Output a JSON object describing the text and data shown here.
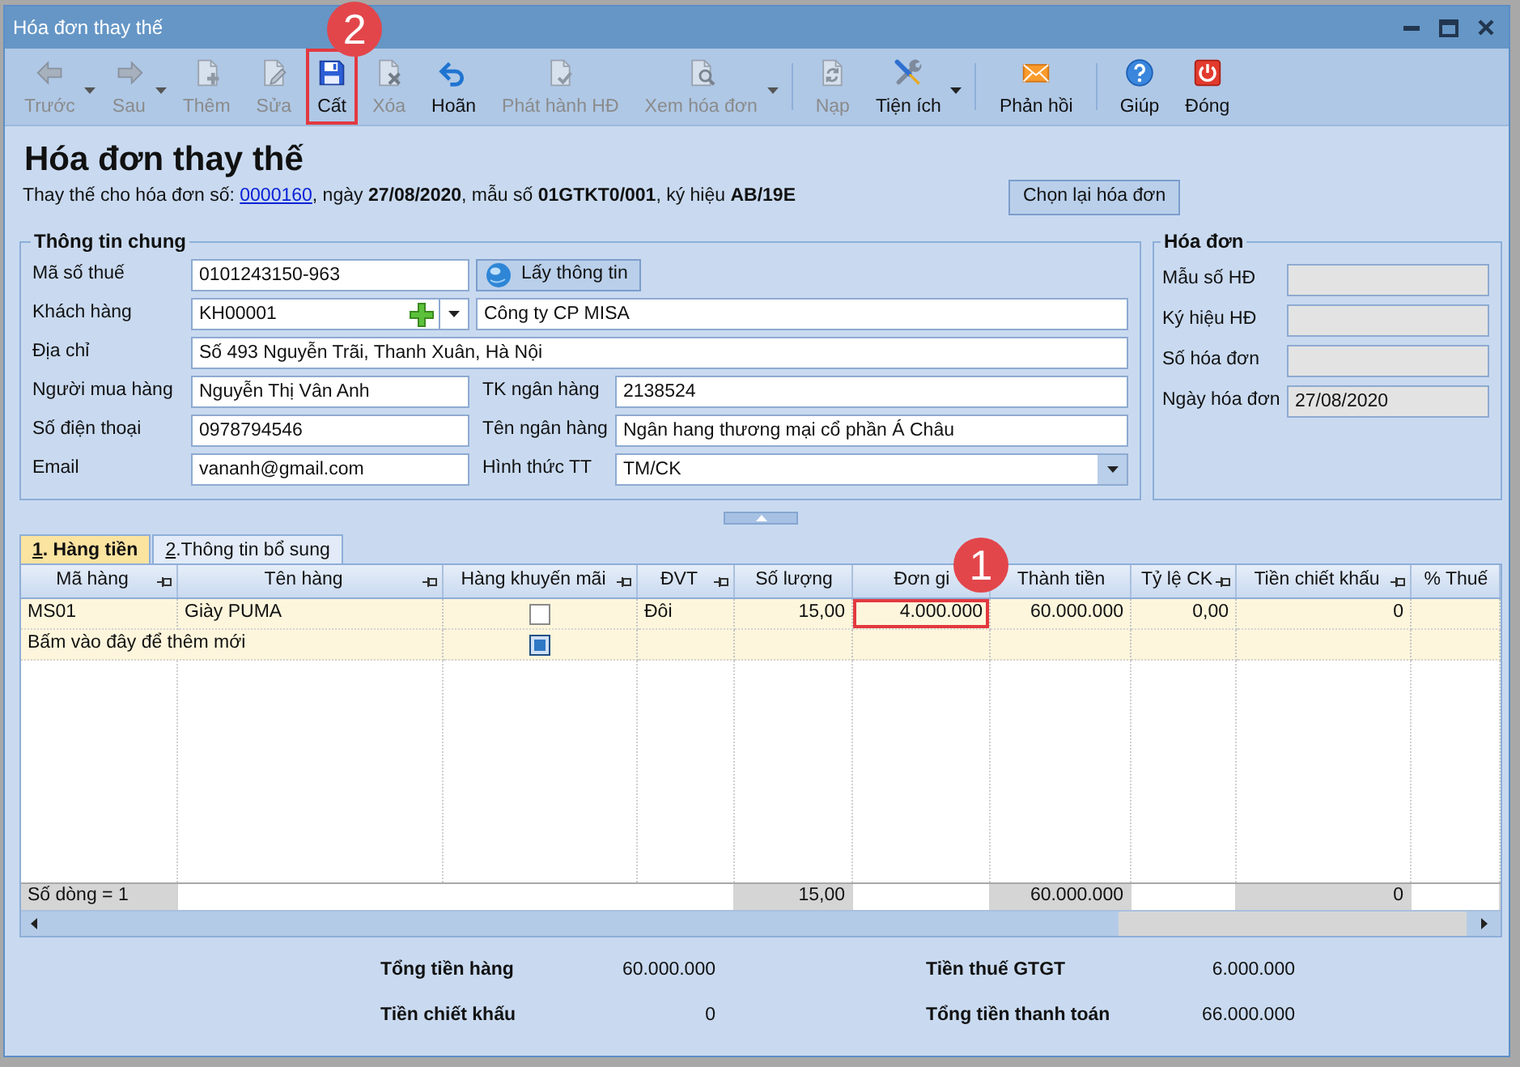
{
  "window": {
    "title": "Hóa đơn thay thế"
  },
  "toolbar": [
    {
      "buttons": [
        {
          "kind": "back",
          "label": "Trước",
          "disabled": true,
          "dropdown": true
        },
        {
          "kind": "forward",
          "label": "Sau",
          "disabled": true,
          "dropdown": true
        },
        {
          "kind": "add",
          "label": "Thêm",
          "disabled": true,
          "dropdown": false
        },
        {
          "kind": "edit",
          "label": "Sửa",
          "disabled": true,
          "dropdown": false
        },
        {
          "kind": "save",
          "label": "Cất",
          "disabled": false,
          "dropdown": false,
          "callout": "2"
        },
        {
          "kind": "delete",
          "label": "Xóa",
          "disabled": true,
          "dropdown": false
        },
        {
          "kind": "undo",
          "label": "Hoãn",
          "disabled": false,
          "dropdown": false
        },
        {
          "kind": "issue",
          "label": "Phát hành HĐ",
          "disabled": true,
          "dropdown": false
        },
        {
          "kind": "view",
          "label": "Xem hóa đơn",
          "disabled": true,
          "dropdown": true
        }
      ]
    },
    {
      "buttons": [
        {
          "kind": "reload",
          "label": "Nạp",
          "disabled": true,
          "dropdown": false
        },
        {
          "kind": "tools",
          "label": "Tiện ích",
          "disabled": false,
          "dropdown": true
        }
      ]
    },
    {
      "buttons": [
        {
          "kind": "feedback",
          "label": "Phản hồi",
          "disabled": false,
          "dropdown": false
        }
      ]
    },
    {
      "buttons": [
        {
          "kind": "help",
          "label": "Giúp",
          "disabled": false,
          "dropdown": false
        },
        {
          "kind": "close",
          "label": "Đóng",
          "disabled": false,
          "dropdown": false
        }
      ]
    }
  ],
  "heading": "Hóa đơn thay thế",
  "note": {
    "text": "Thay thế cho hóa đơn số: ",
    "link": "0000160",
    "rest": ", ngày **27/08/2020**, mẫu số **01GTKT0/001**, ký hiệu **AB/19E**"
  },
  "reselect_button": "Chọn lại hóa đơn",
  "general_info": {
    "legend": "Thông tin chung",
    "tax_code": {
      "label": "Mã số thuế",
      "value": "0101243150-963"
    },
    "fetch_button": "Lấy thông tin",
    "customer": {
      "label": "Khách hàng",
      "code": "KH00001",
      "name": "Công ty CP MISA"
    },
    "address": {
      "label": "Địa chỉ",
      "value": "Số 493 Nguyễn Trãi, Thanh Xuân, Hà Nội"
    },
    "buyer": {
      "label": "Người mua hàng",
      "value": "Nguyễn Thị Vân Anh"
    },
    "bank_account": {
      "label": "TK ngân hàng",
      "value": "2138524"
    },
    "phone": {
      "label": "Số điện thoại",
      "value": "0978794546"
    },
    "bank_name": {
      "label": "Tên ngân hàng",
      "value": "Ngân hang thương mại cổ phần Á Châu"
    },
    "email": {
      "label": "Email",
      "value": "vananh@gmail.com"
    },
    "payment_method": {
      "label": "Hình thức TT",
      "value": "TM/CK"
    }
  },
  "invoice_info": {
    "legend": "Hóa đơn",
    "fields": [
      {
        "label": "Mẫu số HĐ",
        "disabled": true
      },
      {
        "label": "Ký hiệu HĐ",
        "disabled": true
      },
      {
        "label": "Số hóa đơn",
        "disabled": true
      },
      {
        "label": "Ngày hóa đơn",
        "value": "27/08/2020",
        "disabled": true
      }
    ]
  },
  "tabs": [
    {
      "label": "1. Hàng tiền",
      "selected": true
    },
    {
      "label": "2.Thông tin bổ sung",
      "selected": false
    }
  ],
  "grid": {
    "columns": [
      {
        "label": "Mã hàng",
        "pinned": true
      },
      {
        "label": "Tên hàng",
        "pinned": true
      },
      {
        "label": "Hàng khuyến mãi",
        "pinned": true
      },
      {
        "label": "ĐVT",
        "pinned": true
      },
      {
        "label": "Số lượng",
        "pinned": false
      },
      {
        "label": "Đơn gi",
        "pinned": false
      },
      {
        "label": "Thành tiền",
        "pinned": false
      },
      {
        "label": "Tỷ lệ CK",
        "pinned": true
      },
      {
        "label": "Tiền chiết khấu",
        "pinned": true
      },
      {
        "label": "% Thuế",
        "pinned": false
      }
    ],
    "rows": [
      {
        "cells": [
          {
            "kind": "text",
            "text": "MS01"
          },
          {
            "kind": "text",
            "text": "Giày PUMA"
          },
          {
            "kind": "checkbox",
            "checked": false,
            "indeterminate": false
          },
          {
            "kind": "text",
            "text": "Đôi"
          },
          {
            "kind": "number",
            "text": "15,00"
          },
          {
            "kind": "number",
            "text": "4.000.000",
            "callout": "1"
          },
          {
            "kind": "number",
            "text": "60.000.000"
          },
          {
            "kind": "number",
            "text": "0,00"
          },
          {
            "kind": "number",
            "text": "0"
          }
        ]
      }
    ],
    "new_row": {
      "label": "Bấm vào đây để thêm mới",
      "checkbox": {
        "checked": false,
        "indeterminate": true
      }
    },
    "footer": {
      "row_count": "Số dòng = 1",
      "quantity": "15,00",
      "amount": "60.000.000",
      "discount_amount": "0"
    }
  },
  "totals": [
    {
      "label": "Tổng tiền hàng",
      "value": "60.000.000"
    },
    {
      "label": "Tiền chiết khấu",
      "value": "0"
    },
    {
      "label": "Tiền thuế GTGT",
      "value": "6.000.000"
    },
    {
      "label": "Tổng tiền thanh toán",
      "value": "66.000.000"
    }
  ]
}
